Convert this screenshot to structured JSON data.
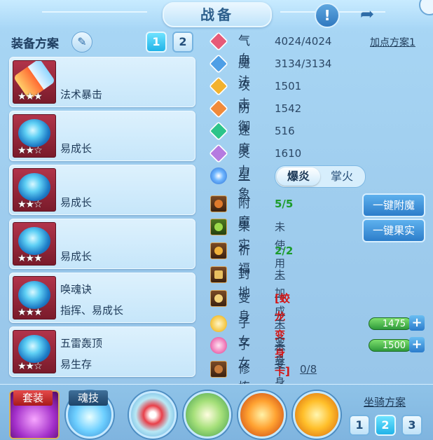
{
  "header": {
    "title": "战备"
  },
  "left": {
    "title": "装备方案",
    "plan_buttons": [
      "1",
      "2"
    ],
    "cards": [
      {
        "name": "",
        "desc": "法术暴击",
        "stars": "★★★"
      },
      {
        "name": "",
        "desc": "易成长",
        "stars": "★★☆"
      },
      {
        "name": "",
        "desc": "易成长",
        "stars": "★★☆"
      },
      {
        "name": "",
        "desc": "易成长",
        "stars": "★★★"
      },
      {
        "name": "唤魂诀",
        "desc": "指挥、易成长",
        "stars": "★★★"
      },
      {
        "name": "五雷轰顶",
        "desc": "易生存",
        "stars": "★★☆"
      }
    ]
  },
  "stats": {
    "plan_link": "加点方案1",
    "rows": [
      {
        "label": "气血",
        "value": "4024/4024",
        "color": "#e65a78"
      },
      {
        "label": "魔法",
        "value": "3134/3134",
        "color": "#4f9fe6"
      },
      {
        "label": "攻击",
        "value": "1501",
        "color": "#f2b22e"
      },
      {
        "label": "防御",
        "value": "1542",
        "color": "#f08a3a"
      },
      {
        "label": "速度",
        "value": "516",
        "color": "#2cc48a"
      },
      {
        "label": "灵力",
        "value": "1610",
        "color": "#b57be0"
      }
    ],
    "xingxiang": {
      "label": "星象",
      "on": "爆炎",
      "off": "掌火"
    }
  },
  "enhance": {
    "rows": [
      {
        "label": "附魔",
        "value": "5/5"
      },
      {
        "label": "果实",
        "value": "未使用"
      },
      {
        "label": "祈福",
        "value": "2/2"
      },
      {
        "label": "封地",
        "value": "未加成"
      },
      {
        "label": "变身",
        "value": "[蛟龙变身卡]"
      },
      {
        "label": "子女",
        "value": "未变身",
        "bar": "1475"
      },
      {
        "label": "子女",
        "value": "未变身",
        "bar": "1500"
      },
      {
        "label": "修炼觉醒",
        "value": "0/8"
      }
    ],
    "btn_fumo": "一键附魔",
    "btn_guoshi": "一键果实"
  },
  "bottom": {
    "suit_label": "套装",
    "soul_label": "魂技",
    "mount_title": "坐骑方案",
    "mount_buttons": [
      "1",
      "2",
      "3"
    ]
  }
}
